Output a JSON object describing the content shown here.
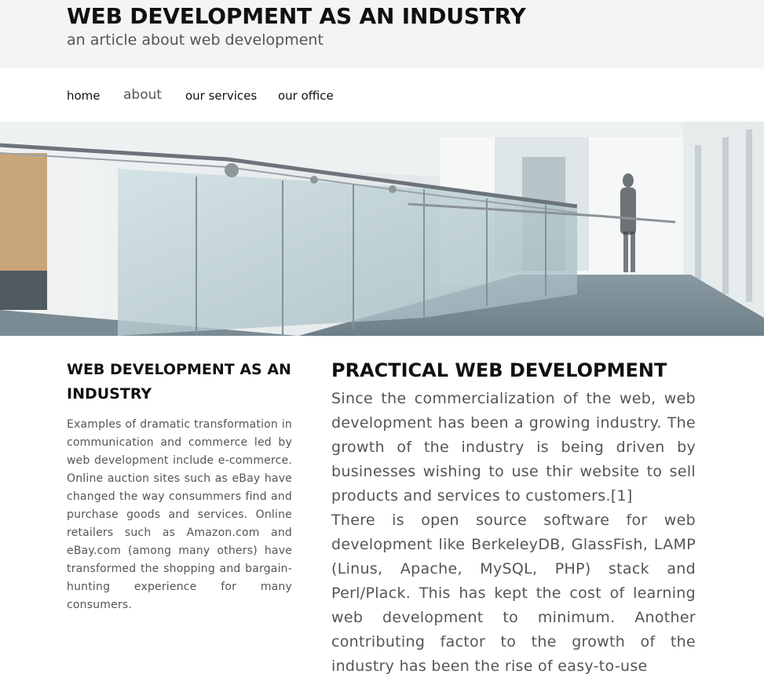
{
  "header": {
    "title": "WEB DEVELOPMENT AS AN INDUSTRY",
    "subtitle": "an article about web development"
  },
  "nav": {
    "items": [
      {
        "label": "home",
        "active": false
      },
      {
        "label": "about",
        "active": true
      },
      {
        "label": "our services",
        "active": false
      },
      {
        "label": "our office",
        "active": false
      }
    ]
  },
  "banner": {
    "description_icon": "office-interior-photo"
  },
  "sidebar": {
    "title": "WEB DEVELOPMENT AS AN INDUSTRY",
    "text": "Examples of dramatic transformation in communication and commerce led by web development include e-commerce. Online auction sites such as eBay have changed the way consummers find and purchase goods and services. Online retailers such as Amazon.com and eBay.com (among many others) have transformed the shopping and bargain-hunting experience for many consumers."
  },
  "main": {
    "title": "PRACTICAL WEB DEVELOPMENT",
    "paragraphs": [
      "Since the commercialization of the web, web development has been a growing industry. The growth of the industry is being driven by businesses wishing to use thir website to sell products and services to customers.[1]",
      "There is open source software for web development like BerkeleyDB, GlassFish, LAMP (Linus, Apache, MySQL, PHP) stack and Perl/Plack. This has kept the cost of learning web development to minimum. Another contributing factor to the growth of the industry has been the rise of easy-to-use"
    ]
  },
  "colors": {
    "header_bg": "#f3f4f3",
    "text_dark": "#111111",
    "text_muted": "#555555"
  }
}
